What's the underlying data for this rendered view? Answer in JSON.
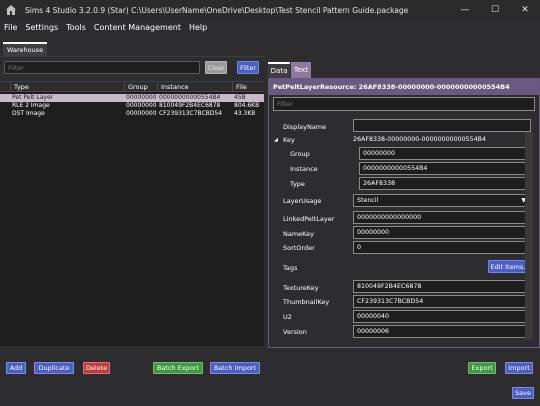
{
  "window": {
    "title": "Sims 4 Studio 3.2.0.9 (Star)   C:\\Users\\UserName\\OneDrive\\Desktop\\Test Stencil Pattern Guide.package",
    "minimize": "—",
    "maximize": "☐",
    "close": "✕"
  },
  "menu": [
    "File",
    "Settings",
    "Tools",
    "Content Management",
    "Help"
  ],
  "warehouse": {
    "tab_label": "Warehouse",
    "filter_placeholder": "Filter",
    "clear_label": "Clear",
    "filter_button": "Filter",
    "columns": [
      "Type",
      "Group",
      "Instance",
      "File"
    ],
    "rows": [
      {
        "type": "Pet Pelt Layer",
        "group": "00000000",
        "instance": "00000000000554B4",
        "file": "45B",
        "selected": true
      },
      {
        "type": "RLE 2 Image",
        "group": "00000000",
        "instance": "810049F2B4EC6878",
        "file": "804.6KB",
        "selected": false
      },
      {
        "type": "DST Image",
        "group": "00000000",
        "instance": "CF239313C7BCBD54",
        "file": "43.3KB",
        "selected": false
      }
    ]
  },
  "bottom_buttons": {
    "add": "Add",
    "duplicate": "Duplicate",
    "delete": "Delete",
    "batch_export": "Batch Export",
    "batch_import": "Batch Import",
    "export": "Export",
    "import": "Import",
    "save": "Save"
  },
  "properties": {
    "tab_data": "Data",
    "tab_text": "Text",
    "resource_header": "PetPeltLayerResource: 26AF8338-00000000-00000000000554B4",
    "filter_placeholder": "Filter",
    "display_name_label": "DisplayName",
    "display_name_value": "",
    "key_label": "Key",
    "key_value": "26AF8338-00000000-00000000000554B4",
    "key_toggle": "◢",
    "group_label": "Group",
    "group_value": "00000000",
    "instance_label": "Instance",
    "instance_value": "00000000000554B4",
    "type_label": "Type",
    "type_value": "26AF8338",
    "layer_usage_label": "LayerUsage",
    "layer_usage_value": "Stencil",
    "linked_pelt_layer_label": "LinkedPeltLayer",
    "linked_pelt_layer_value": "0000000000000000",
    "name_key_label": "NameKey",
    "name_key_value": "00000000",
    "sort_order_label": "SortOrder",
    "sort_order_value": "0",
    "tags_label": "Tags",
    "edit_items_label": "Edit Items...",
    "texture_key_label": "TextureKey",
    "texture_key_value": "810049F2B4EC6878",
    "thumbnail_key_label": "ThumbnailKey",
    "thumbnail_key_value": "CF239313C7BCBD54",
    "u2_label": "U2",
    "u2_value": "00000040",
    "version_label": "Version",
    "version_value": "00000006"
  },
  "colors": {
    "background": "#2d2d30",
    "accent_blue": "#4a5ec5",
    "accent_red": "#c23b3b",
    "accent_green": "#3f9a3f",
    "header_purple": "#6b5a80",
    "selected_row": "#c8b8cc"
  }
}
